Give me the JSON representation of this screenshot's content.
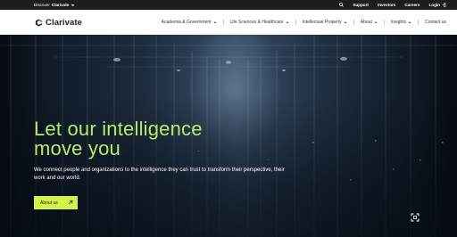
{
  "topbar": {
    "discover_prefix": "Discover",
    "discover_brand": "Clarivate",
    "links": [
      "Support",
      "Investors",
      "Careers",
      "Login"
    ]
  },
  "nav": {
    "logo_text": "Clarivate",
    "items": [
      {
        "label": "Academia & Government",
        "dropdown": true
      },
      {
        "label": "Life Sciences & Healthcare",
        "dropdown": true
      },
      {
        "label": "Intellectual Property",
        "dropdown": true
      },
      {
        "label": "About",
        "dropdown": true
      },
      {
        "label": "Insights",
        "dropdown": true
      },
      {
        "label": "Contact us",
        "dropdown": false
      }
    ]
  },
  "hero": {
    "headline_line1": "Let our intelligence",
    "headline_line2": "move you",
    "subtext": "We connect people and organizations to the intelligence they can trust to transform their perspective, their work and our world.",
    "cta_label": "About us"
  },
  "colors": {
    "accent_green": "#b7ea6c",
    "cta_bg": "#d4f24a",
    "topbar_bg": "#1d1d1d",
    "hero_bg": "#1c2a3b"
  },
  "icons": [
    "chevron-down-icon",
    "search-icon",
    "login-icon",
    "arrow-up-right-icon",
    "fullscreen-icon"
  ]
}
